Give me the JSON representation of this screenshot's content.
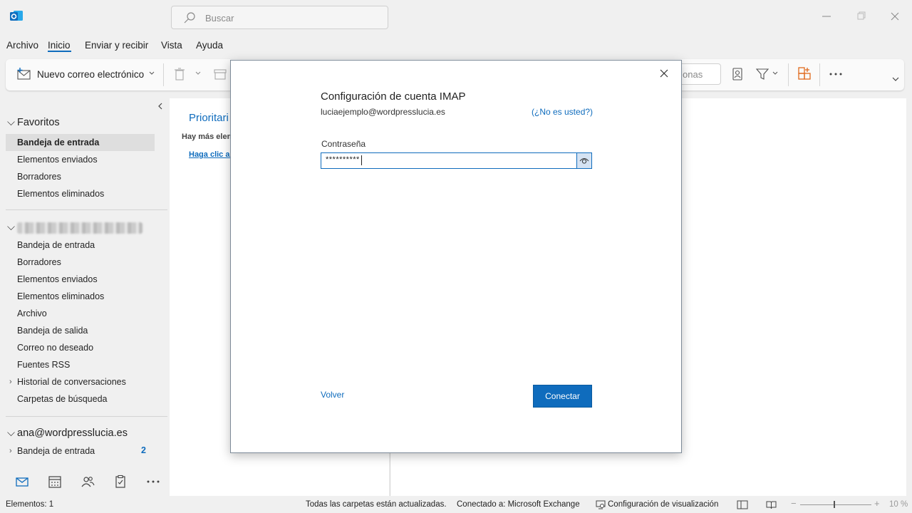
{
  "search": {
    "placeholder": "Buscar"
  },
  "menu": {
    "items": [
      "Archivo",
      "Inicio",
      "Enviar y recibir",
      "Vista",
      "Ayuda"
    ],
    "active": "Inicio"
  },
  "ribbon": {
    "new_mail": "Nuevo correo electrónico",
    "people_fragment": "onas"
  },
  "sidebar": {
    "favorites_title": "Favoritos",
    "favorites": [
      "Bandeja de entrada",
      "Elementos enviados",
      "Borradores",
      "Elementos eliminados"
    ],
    "account2_folders": [
      "Bandeja de entrada",
      "Borradores",
      "Elementos enviados",
      "Elementos eliminados",
      "Archivo",
      "Bandeja de salida",
      "Correo no deseado",
      "Fuentes RSS",
      "Historial de conversaciones",
      "Carpetas de búsqueda"
    ],
    "account3_title": "ana@wordpresslucia.es",
    "account3_inbox": "Bandeja de entrada",
    "account3_unread": "2"
  },
  "middle": {
    "tab": "Prioritari",
    "info": "Hay más elem",
    "link": "Haga clic ac"
  },
  "status": {
    "items": "Elementos: 1",
    "sync": "Todas las carpetas están actualizadas.",
    "connected": "Conectado a: Microsoft Exchange",
    "display": "Configuración de visualización",
    "zoom": "10 %"
  },
  "dialog": {
    "title": "Configuración de cuenta IMAP",
    "email": "luciaejemplo@wordpresslucia.es",
    "not_you": "(¿No es usted?)",
    "password_label": "Contraseña",
    "password_value": "**********",
    "back": "Volver",
    "connect": "Conectar"
  },
  "colors": {
    "accent": "#0f6cbd"
  }
}
